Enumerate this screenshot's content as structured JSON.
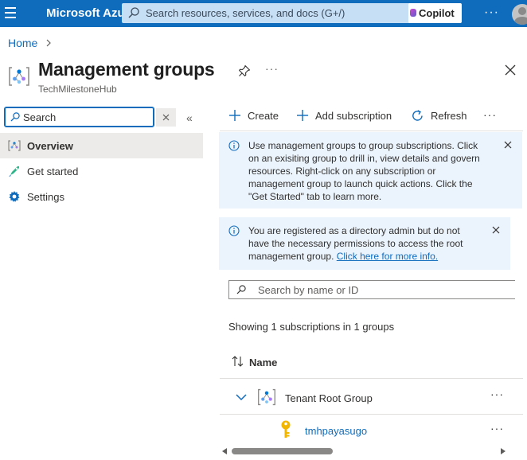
{
  "topbar": {
    "brand": "Microsoft Azure",
    "search_placeholder": "Search resources, services, and docs (G+/)",
    "copilot_label": "Copilot",
    "more_label": "···",
    "colors": {
      "bar": "#0f6cbd",
      "search": "#c7dff5"
    }
  },
  "breadcrumb": {
    "home": "Home",
    "separator": ">"
  },
  "header": {
    "title": "Management groups",
    "subtitle": "TechMilestoneHub",
    "more_label": "···",
    "icons": [
      "management-group-icon",
      "pin-icon",
      "close-icon"
    ]
  },
  "nav": {
    "search_placeholder": "Search",
    "collapse_label": "«",
    "items": [
      {
        "label": "Overview",
        "icon": "overview-icon",
        "active": true
      },
      {
        "label": "Get started",
        "icon": "rocket-icon",
        "active": false
      },
      {
        "label": "Settings",
        "icon": "gear-icon",
        "active": false
      }
    ]
  },
  "toolbar": {
    "create_label": "Create",
    "add_subscription_label": "Add subscription",
    "refresh_label": "Refresh",
    "more_label": "···"
  },
  "banners": [
    {
      "text": "Use management groups to group subscriptions. Click on an exisiting group to drill in, view details and govern resources. Right-click on any subscription or management group to launch quick actions. Click the \"Get Started\" tab to learn more.",
      "lines": [
        "Use management groups to group subscriptions. Click",
        "on an exisiting group to drill in, view details and govern",
        "resources. Right-click on any subscription or",
        "management group to launch quick actions. Click the",
        "\"Get Started\" tab to learn more."
      ]
    },
    {
      "lines": [
        "You are registered as a directory admin but do not",
        "have the necessary permissions to access the root",
        "management group. "
      ],
      "link": "Click here for more info."
    }
  ],
  "filter": {
    "placeholder": "Search by name or ID"
  },
  "summary": "Showing 1 subscriptions in 1 groups",
  "grid": {
    "column_name": "Name",
    "rows": [
      {
        "label": "Tenant Root Group",
        "type": "management-group",
        "expanded": true,
        "more": "···"
      },
      {
        "label": "tmhpayasugo",
        "type": "subscription",
        "more": "···"
      }
    ]
  },
  "colors": {
    "accent": "#0f6cbd",
    "banner_bg": "#ebf3fc",
    "nav_active": "#edebe9"
  }
}
